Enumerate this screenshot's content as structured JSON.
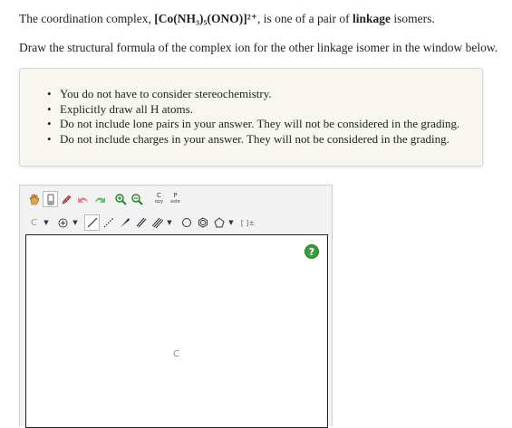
{
  "question": {
    "p1_prefix": "The coordination complex, ",
    "complex_formula": "[Co(NH₃)₅(ONO)]²⁺",
    "p1_mid": ", is one of a pair of ",
    "keyword": "linkage",
    "p1_suffix": " isomers.",
    "p2": "Draw the structural formula of the complex ion for the other linkage isomer in the window below."
  },
  "notes": [
    "You do not have to consider stereochemistry.",
    "Explicitly draw all H atoms.",
    "Do not include lone pairs in your answer. They will not be considered in the grading.",
    "Do not include charges in your answer. They will not be considered in the grading."
  ],
  "editor": {
    "toolbar1": {
      "copy_label": "C",
      "copy_sub": "opy",
      "paste_label": "P",
      "paste_sub": "aste"
    },
    "toolbar2": {
      "element_label": "C",
      "template_label": "[ ]±"
    },
    "canvas_element": "C",
    "help_label": "?",
    "colors": {
      "help": "#3c9a3c",
      "pencil": "#d9534f",
      "undo": "#e8848c",
      "redo": "#6cbf6c",
      "zoom": "#2e7d32"
    }
  }
}
